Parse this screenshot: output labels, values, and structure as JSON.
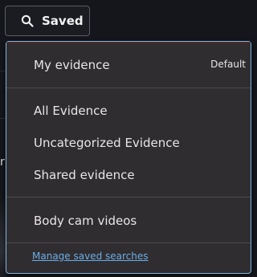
{
  "toolbar": {
    "saved_label": "Saved",
    "search_icon": "search-icon"
  },
  "menu": {
    "my_evidence": {
      "label": "My evidence",
      "badge": "Default"
    },
    "groups": [
      [
        "All Evidence",
        "Uncategorized Evidence",
        "Shared evidence"
      ],
      [
        "Body cam videos"
      ]
    ],
    "manage_link": "Manage saved searches"
  },
  "colors": {
    "accent_border": "#7fb8e0",
    "link": "#6aaee6",
    "menu_bg": "#302d30"
  }
}
